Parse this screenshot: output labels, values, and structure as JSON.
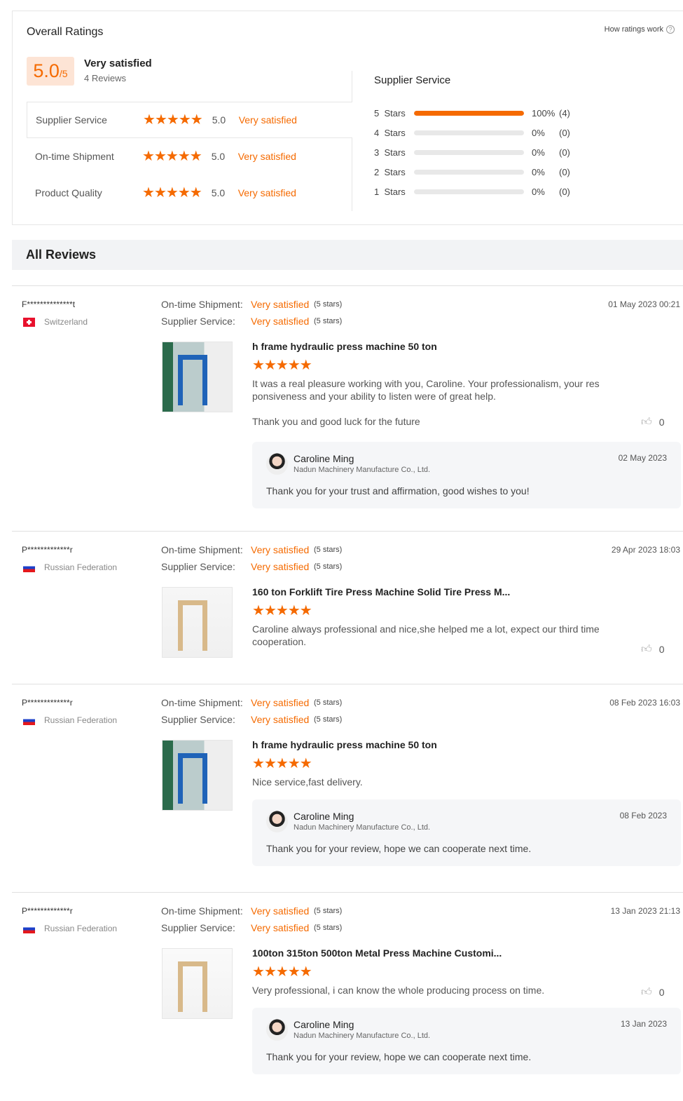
{
  "overall": {
    "title": "Overall Ratings",
    "how_link": "How ratings work",
    "score": "5.0",
    "out_of": "/5",
    "summary": "Very satisfied",
    "review_count": "4 Reviews",
    "categories": [
      {
        "label": "Supplier Service",
        "score": "5.0",
        "text": "Very satisfied",
        "stars": 5
      },
      {
        "label": "On-time Shipment",
        "score": "5.0",
        "text": "Very satisfied",
        "stars": 5
      },
      {
        "label": "Product Quality",
        "score": "5.0",
        "text": "Very satisfied",
        "stars": 5
      }
    ]
  },
  "breakdown": {
    "title": "Supplier Service",
    "rows": [
      {
        "label": "5  Stars",
        "pct": "100%",
        "count": "(4)",
        "value": 100
      },
      {
        "label": "4  Stars",
        "pct": "0%",
        "count": "(0)",
        "value": 0
      },
      {
        "label": "3  Stars",
        "pct": "0%",
        "count": "(0)",
        "value": 0
      },
      {
        "label": "2  Stars",
        "pct": "0%",
        "count": "(0)",
        "value": 0
      },
      {
        "label": "1  Stars",
        "pct": "0%",
        "count": "(0)",
        "value": 0
      }
    ]
  },
  "all_reviews_title": "All Reviews",
  "colors": {
    "accent": "#f56a00"
  },
  "reviews": [
    {
      "user": "F**************t",
      "country": "Switzerland",
      "flag": "ch",
      "date": "01 May 2023 00:21",
      "ship_label": "On-time Shipment:",
      "ship_value": "Very satisfied",
      "ship_count": "(5 stars)",
      "svc_label": "Supplier Service:",
      "svc_value": "Very satisfied",
      "svc_count": "(5 stars)",
      "product": "h frame hydraulic press machine 50 ton",
      "stars": 5,
      "text": "It was a real pleasure working with you, Caroline. Your professionalism, your responsiveness and your ability to listen were of great help.",
      "text2": "Thank you and good luck for the future",
      "likes": "0",
      "reply": {
        "name": "Caroline Ming",
        "company": "Nadun Machinery Manufacture Co., Ltd.",
        "date": "02 May 2023",
        "text": "Thank you for your trust and affirmation, good wishes to you!"
      }
    },
    {
      "user": "P*************r",
      "country": "Russian Federation",
      "flag": "ru",
      "date": "29 Apr 2023 18:03",
      "ship_label": "On-time Shipment:",
      "ship_value": "Very satisfied",
      "ship_count": "(5 stars)",
      "svc_label": "Supplier Service:",
      "svc_value": "Very satisfied",
      "svc_count": "(5 stars)",
      "product": "160 ton Forklift Tire Press Machine Solid Tire Press M...",
      "stars": 5,
      "text": "Caroline always professional and nice,she helped me a lot, expect our third time cooperation.",
      "likes": "0"
    },
    {
      "user": "P*************r",
      "country": "Russian Federation",
      "flag": "ru",
      "date": "08 Feb 2023 16:03",
      "ship_label": "On-time Shipment:",
      "ship_value": "Very satisfied",
      "ship_count": "(5 stars)",
      "svc_label": "Supplier Service:",
      "svc_value": "Very satisfied",
      "svc_count": "(5 stars)",
      "product": "h frame hydraulic press machine 50 ton",
      "stars": 5,
      "text": "Nice service,fast delivery.",
      "likes": "0",
      "reply": {
        "name": "Caroline Ming",
        "company": "Nadun Machinery Manufacture Co., Ltd.",
        "date": "08 Feb 2023",
        "text": "Thank you for your review, hope we can cooperate next time."
      }
    },
    {
      "user": "P*************r",
      "country": "Russian Federation",
      "flag": "ru",
      "date": "13 Jan 2023 21:13",
      "ship_label": "On-time Shipment:",
      "ship_value": "Very satisfied",
      "ship_count": "(5 stars)",
      "svc_label": "Supplier Service:",
      "svc_value": "Very satisfied",
      "svc_count": "(5 stars)",
      "product": "100ton 315ton 500ton Metal Press Machine Customi...",
      "stars": 5,
      "text": "Very professional, i can know the whole producing process on time.",
      "likes": "0",
      "reply": {
        "name": "Caroline Ming",
        "company": "Nadun Machinery Manufacture Co., Ltd.",
        "date": "13 Jan 2023",
        "text": "Thank you for your review, hope we can cooperate next time."
      }
    }
  ]
}
